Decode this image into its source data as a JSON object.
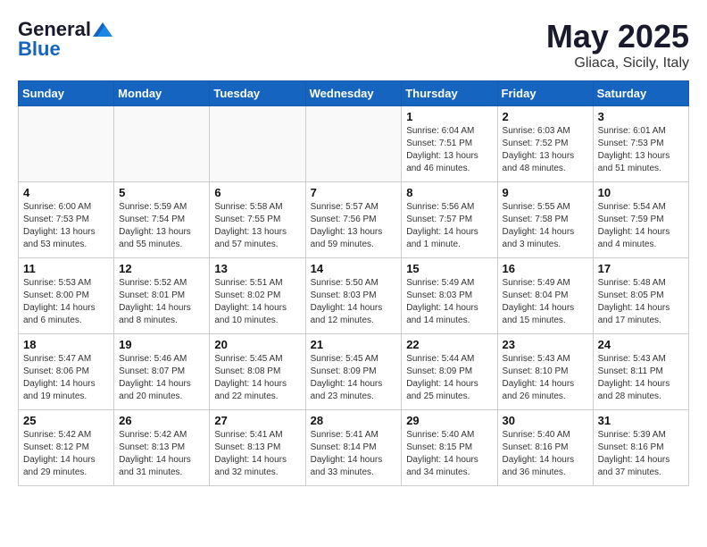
{
  "header": {
    "logo_general": "General",
    "logo_blue": "Blue",
    "month": "May 2025",
    "location": "Gliaca, Sicily, Italy"
  },
  "weekdays": [
    "Sunday",
    "Monday",
    "Tuesday",
    "Wednesday",
    "Thursday",
    "Friday",
    "Saturday"
  ],
  "weeks": [
    [
      {
        "day": "",
        "info": ""
      },
      {
        "day": "",
        "info": ""
      },
      {
        "day": "",
        "info": ""
      },
      {
        "day": "",
        "info": ""
      },
      {
        "day": "1",
        "info": "Sunrise: 6:04 AM\nSunset: 7:51 PM\nDaylight: 13 hours\nand 46 minutes."
      },
      {
        "day": "2",
        "info": "Sunrise: 6:03 AM\nSunset: 7:52 PM\nDaylight: 13 hours\nand 48 minutes."
      },
      {
        "day": "3",
        "info": "Sunrise: 6:01 AM\nSunset: 7:53 PM\nDaylight: 13 hours\nand 51 minutes."
      }
    ],
    [
      {
        "day": "4",
        "info": "Sunrise: 6:00 AM\nSunset: 7:53 PM\nDaylight: 13 hours\nand 53 minutes."
      },
      {
        "day": "5",
        "info": "Sunrise: 5:59 AM\nSunset: 7:54 PM\nDaylight: 13 hours\nand 55 minutes."
      },
      {
        "day": "6",
        "info": "Sunrise: 5:58 AM\nSunset: 7:55 PM\nDaylight: 13 hours\nand 57 minutes."
      },
      {
        "day": "7",
        "info": "Sunrise: 5:57 AM\nSunset: 7:56 PM\nDaylight: 13 hours\nand 59 minutes."
      },
      {
        "day": "8",
        "info": "Sunrise: 5:56 AM\nSunset: 7:57 PM\nDaylight: 14 hours\nand 1 minute."
      },
      {
        "day": "9",
        "info": "Sunrise: 5:55 AM\nSunset: 7:58 PM\nDaylight: 14 hours\nand 3 minutes."
      },
      {
        "day": "10",
        "info": "Sunrise: 5:54 AM\nSunset: 7:59 PM\nDaylight: 14 hours\nand 4 minutes."
      }
    ],
    [
      {
        "day": "11",
        "info": "Sunrise: 5:53 AM\nSunset: 8:00 PM\nDaylight: 14 hours\nand 6 minutes."
      },
      {
        "day": "12",
        "info": "Sunrise: 5:52 AM\nSunset: 8:01 PM\nDaylight: 14 hours\nand 8 minutes."
      },
      {
        "day": "13",
        "info": "Sunrise: 5:51 AM\nSunset: 8:02 PM\nDaylight: 14 hours\nand 10 minutes."
      },
      {
        "day": "14",
        "info": "Sunrise: 5:50 AM\nSunset: 8:03 PM\nDaylight: 14 hours\nand 12 minutes."
      },
      {
        "day": "15",
        "info": "Sunrise: 5:49 AM\nSunset: 8:03 PM\nDaylight: 14 hours\nand 14 minutes."
      },
      {
        "day": "16",
        "info": "Sunrise: 5:49 AM\nSunset: 8:04 PM\nDaylight: 14 hours\nand 15 minutes."
      },
      {
        "day": "17",
        "info": "Sunrise: 5:48 AM\nSunset: 8:05 PM\nDaylight: 14 hours\nand 17 minutes."
      }
    ],
    [
      {
        "day": "18",
        "info": "Sunrise: 5:47 AM\nSunset: 8:06 PM\nDaylight: 14 hours\nand 19 minutes."
      },
      {
        "day": "19",
        "info": "Sunrise: 5:46 AM\nSunset: 8:07 PM\nDaylight: 14 hours\nand 20 minutes."
      },
      {
        "day": "20",
        "info": "Sunrise: 5:45 AM\nSunset: 8:08 PM\nDaylight: 14 hours\nand 22 minutes."
      },
      {
        "day": "21",
        "info": "Sunrise: 5:45 AM\nSunset: 8:09 PM\nDaylight: 14 hours\nand 23 minutes."
      },
      {
        "day": "22",
        "info": "Sunrise: 5:44 AM\nSunset: 8:09 PM\nDaylight: 14 hours\nand 25 minutes."
      },
      {
        "day": "23",
        "info": "Sunrise: 5:43 AM\nSunset: 8:10 PM\nDaylight: 14 hours\nand 26 minutes."
      },
      {
        "day": "24",
        "info": "Sunrise: 5:43 AM\nSunset: 8:11 PM\nDaylight: 14 hours\nand 28 minutes."
      }
    ],
    [
      {
        "day": "25",
        "info": "Sunrise: 5:42 AM\nSunset: 8:12 PM\nDaylight: 14 hours\nand 29 minutes."
      },
      {
        "day": "26",
        "info": "Sunrise: 5:42 AM\nSunset: 8:13 PM\nDaylight: 14 hours\nand 31 minutes."
      },
      {
        "day": "27",
        "info": "Sunrise: 5:41 AM\nSunset: 8:13 PM\nDaylight: 14 hours\nand 32 minutes."
      },
      {
        "day": "28",
        "info": "Sunrise: 5:41 AM\nSunset: 8:14 PM\nDaylight: 14 hours\nand 33 minutes."
      },
      {
        "day": "29",
        "info": "Sunrise: 5:40 AM\nSunset: 8:15 PM\nDaylight: 14 hours\nand 34 minutes."
      },
      {
        "day": "30",
        "info": "Sunrise: 5:40 AM\nSunset: 8:16 PM\nDaylight: 14 hours\nand 36 minutes."
      },
      {
        "day": "31",
        "info": "Sunrise: 5:39 AM\nSunset: 8:16 PM\nDaylight: 14 hours\nand 37 minutes."
      }
    ]
  ]
}
